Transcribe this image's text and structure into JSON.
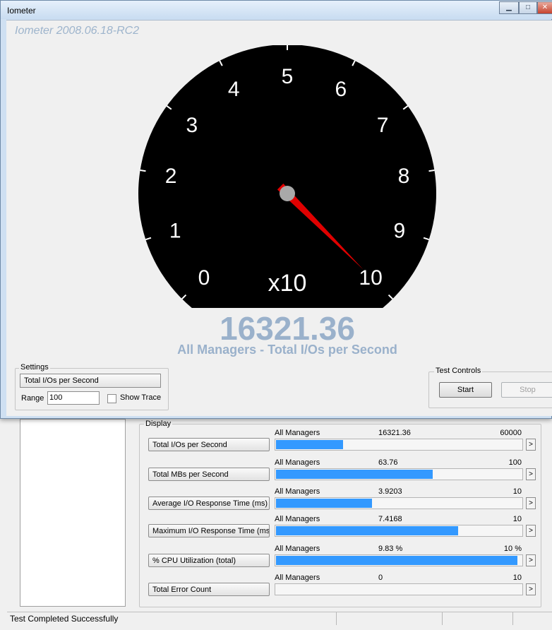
{
  "window": {
    "title": "Iometer",
    "version": "Iometer 2008.06.18-RC2"
  },
  "gauge": {
    "labels": [
      "0",
      "1",
      "2",
      "3",
      "4",
      "5",
      "6",
      "7",
      "8",
      "9",
      "10"
    ],
    "multiplier": "x10",
    "needle_value": 10,
    "readout": "16321.36",
    "readout_label": "All Managers - Total I/Os per Second",
    "needle_color": "#e00000",
    "face_color": "#000000"
  },
  "settings": {
    "legend": "Settings",
    "metric": "Total I/Os per Second",
    "range_label": "Range",
    "range_value": "100",
    "show_trace": "Show Trace",
    "show_trace_checked": false
  },
  "controls": {
    "legend": "Test Controls",
    "start": "Start",
    "stop": "Stop"
  },
  "display": {
    "legend": "Display",
    "rows": [
      {
        "button": "Total I/Os per Second",
        "source": "All Managers",
        "value": "16321.36",
        "max": "60000",
        "fill": 0.272
      },
      {
        "button": "Total MBs per Second",
        "source": "All Managers",
        "value": "63.76",
        "max": "100",
        "fill": 0.6376
      },
      {
        "button": "Average I/O Response Time (ms)",
        "source": "All Managers",
        "value": "3.9203",
        "max": "10",
        "fill": 0.392
      },
      {
        "button": "Maximum I/O Response Time (ms)",
        "source": "All Managers",
        "value": "7.4168",
        "max": "10",
        "fill": 0.7417
      },
      {
        "button": "% CPU Utilization (total)",
        "source": "All Managers",
        "value": "9.83 %",
        "max": "10 %",
        "fill": 0.983
      },
      {
        "button": "Total Error Count",
        "source": "All Managers",
        "value": "0",
        "max": "10",
        "fill": 0
      }
    ],
    "arrow": ">"
  },
  "status": {
    "text": "Test Completed Successfully"
  },
  "colors": {
    "bar": "#3399ff",
    "readout": "#9ab1cb"
  }
}
